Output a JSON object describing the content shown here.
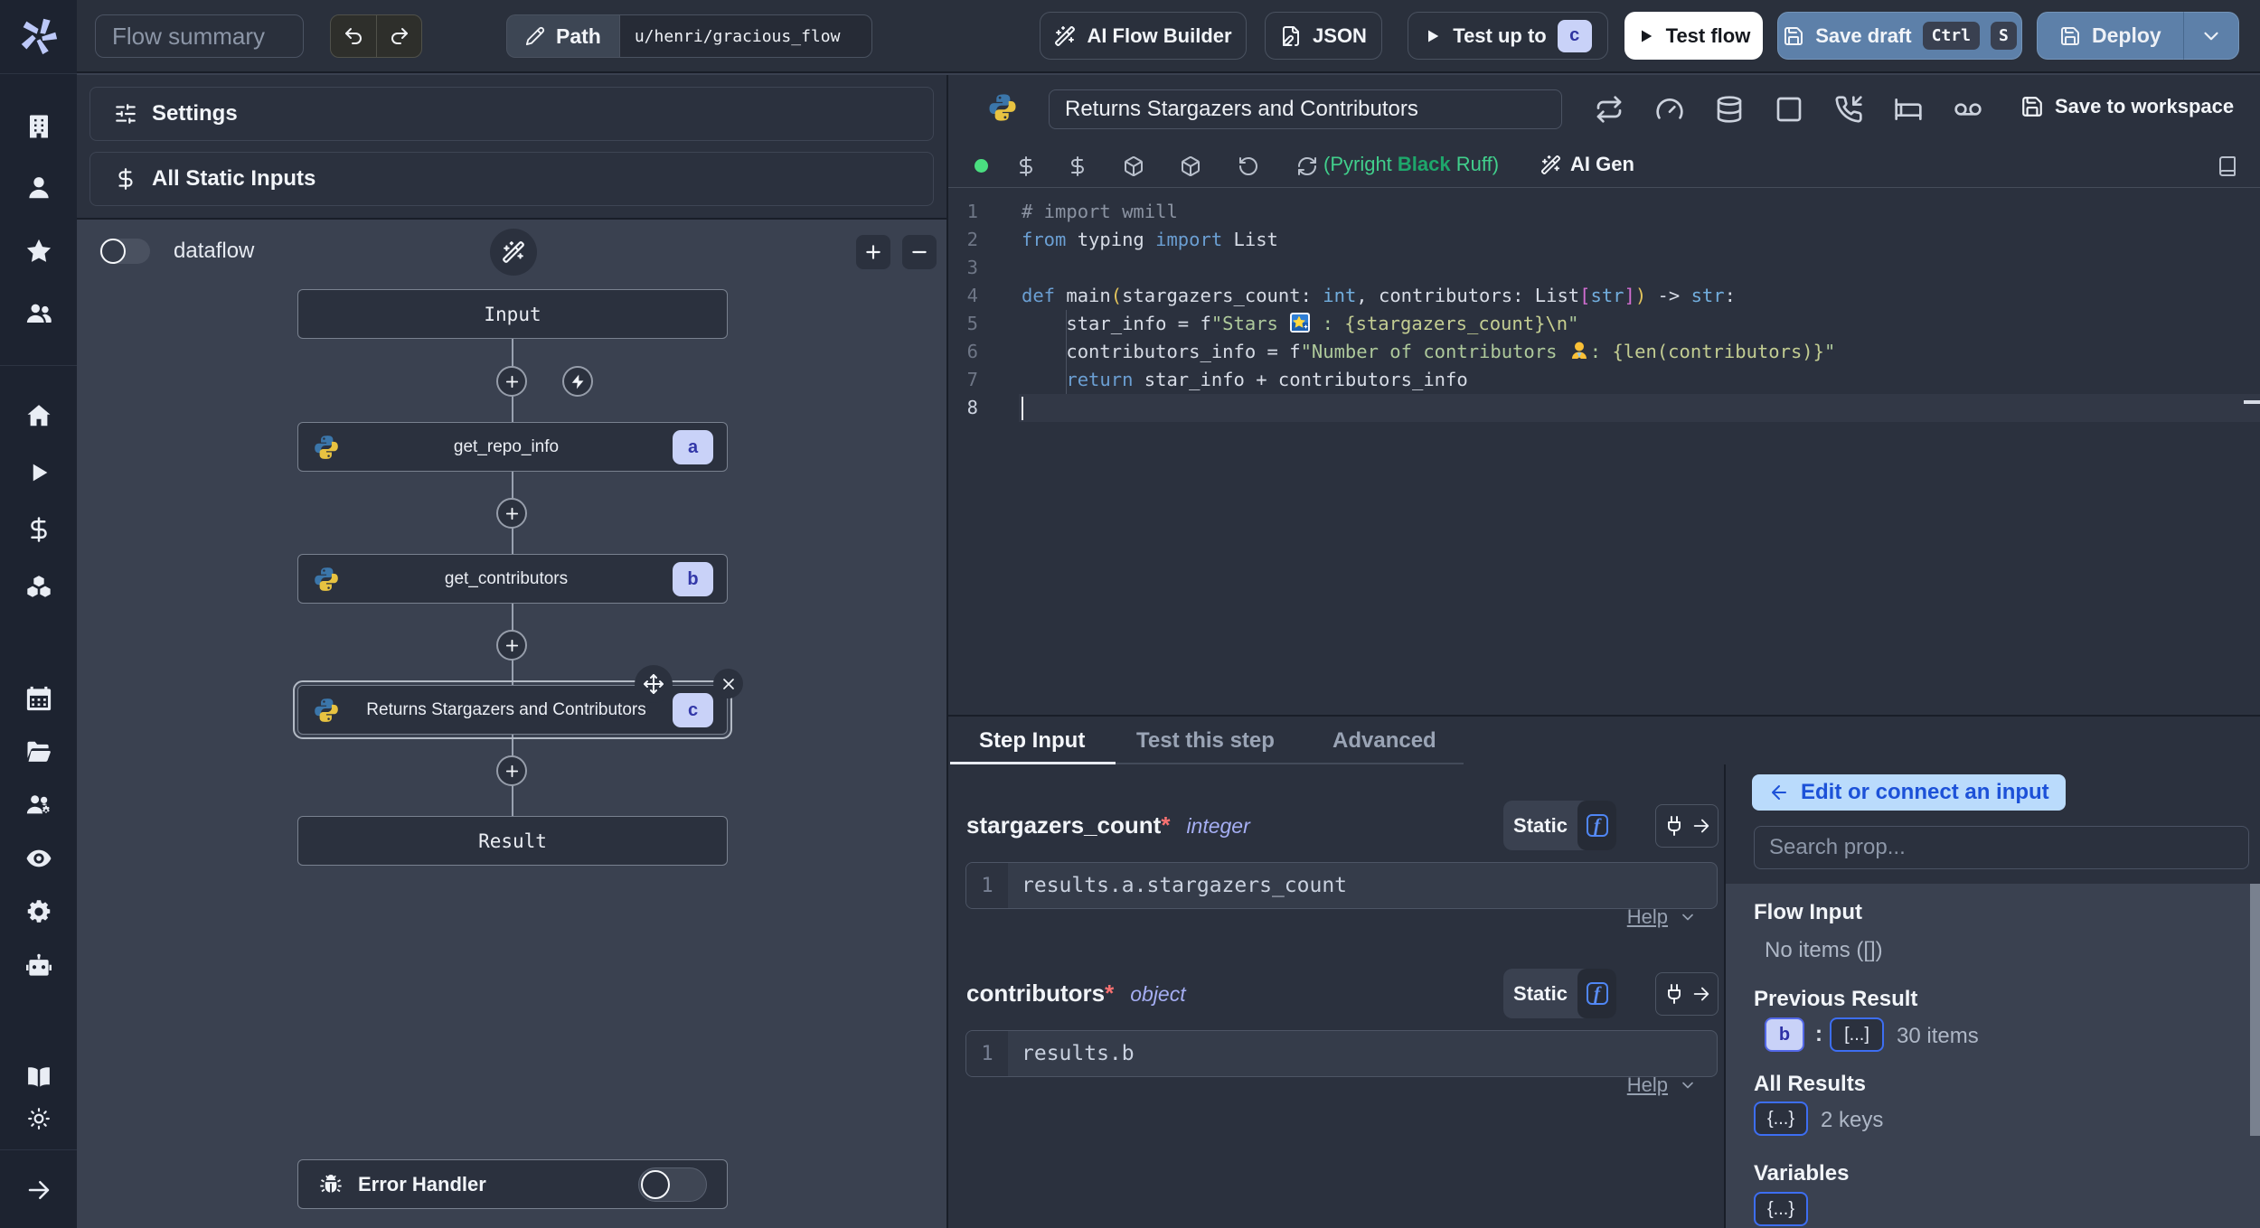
{
  "topbar": {
    "flow_summary_placeholder": "Flow summary",
    "path_label": "Path",
    "path_value": "u/henri/gracious_flow",
    "ai_flow_builder": "AI Flow Builder",
    "json_button": "JSON",
    "test_up_to": "Test up to",
    "test_up_to_badge": "c",
    "test_flow": "Test flow",
    "save_draft": "Save draft",
    "save_draft_keys": [
      "Ctrl",
      "S"
    ],
    "deploy": "Deploy"
  },
  "sidebar": {
    "icons": [
      "windmill-logo",
      "building",
      "user",
      "star",
      "users",
      "home",
      "play",
      "dollar",
      "cubes",
      "calendar",
      "folder-open",
      "users-gear",
      "eye",
      "gear",
      "robot",
      "book-open",
      "sun",
      "arrow-right"
    ]
  },
  "left_panel": {
    "settings": "Settings",
    "all_static_inputs": "All Static Inputs",
    "dataflow_label": "dataflow",
    "error_handler": "Error Handler"
  },
  "graph": {
    "nodes": [
      {
        "label": "Input",
        "kind": "virtual"
      },
      {
        "label": "get_repo_info",
        "badge": "a",
        "icon": "python"
      },
      {
        "label": "get_contributors",
        "badge": "b",
        "icon": "python"
      },
      {
        "label": "Returns Stargazers and Contributors",
        "badge": "c",
        "icon": "python",
        "selected": true
      },
      {
        "label": "Result",
        "kind": "virtual"
      }
    ]
  },
  "editor": {
    "language_icon": "python",
    "title": "Returns Stargazers and Contributors",
    "header_icons": [
      "repeat",
      "gauge",
      "database",
      "square",
      "phone-incoming",
      "bed",
      "voicemail"
    ],
    "save_to_workspace": "Save to workspace",
    "toolbar_icons": [
      "dollar",
      "dollar",
      "box",
      "box",
      "history",
      "refresh"
    ],
    "assistants_prefix": "(Pyright ",
    "assistants_black": "Black",
    "assistants_suffix": " Ruff)",
    "ai_gen": "AI Gen",
    "docs_icon": "book",
    "status_dot_color": "#4ade80",
    "code": {
      "lines": [
        [
          {
            "c": "com",
            "t": "# import wmill"
          }
        ],
        [
          {
            "c": "kw",
            "t": "from"
          },
          {
            "c": "d",
            "t": " typing "
          },
          {
            "c": "kw",
            "t": "import"
          },
          {
            "c": "d",
            "t": " List"
          }
        ],
        [],
        [
          {
            "c": "kw",
            "t": "def"
          },
          {
            "c": "d",
            "t": " main"
          },
          {
            "c": "p1",
            "t": "("
          },
          {
            "c": "d",
            "t": "stargazers_count: "
          },
          {
            "c": "ty",
            "t": "int"
          },
          {
            "c": "d",
            "t": ", contributors: List"
          },
          {
            "c": "p2",
            "t": "["
          },
          {
            "c": "ty",
            "t": "str"
          },
          {
            "c": "p2",
            "t": "]"
          },
          {
            "c": "p1",
            "t": ")"
          },
          {
            "c": "d",
            "t": " -> "
          },
          {
            "c": "ty",
            "t": "str"
          },
          {
            "c": "d",
            "t": ":"
          }
        ],
        [
          {
            "c": "d",
            "t": "    star_info = f"
          },
          {
            "c": "str",
            "t": "\"Stars 🌟 : "
          },
          {
            "c": "interp",
            "t": "{stargazers_count}"
          },
          {
            "c": "esc",
            "t": "\\n"
          },
          {
            "c": "str",
            "t": "\""
          }
        ],
        [
          {
            "c": "d",
            "t": "    contributors_info = f"
          },
          {
            "c": "str",
            "t": "\"Number of contributors 👥: "
          },
          {
            "c": "interp",
            "t": "{len(contributors)}"
          },
          {
            "c": "str",
            "t": "\""
          }
        ],
        [
          {
            "c": "d",
            "t": "    "
          },
          {
            "c": "kw",
            "t": "return"
          },
          {
            "c": "d",
            "t": " star_info + contributors_info"
          }
        ],
        []
      ],
      "active_line": 8
    }
  },
  "tabs": [
    {
      "label": "Step Input",
      "active": true
    },
    {
      "label": "Test this step",
      "active": false
    },
    {
      "label": "Advanced",
      "active": false
    }
  ],
  "step_input": {
    "fields": [
      {
        "name": "stargazers_count",
        "required": "*",
        "type": "integer",
        "mode": "Static",
        "line_no": "1",
        "expr": "results.a.stargazers_count",
        "help": "Help"
      },
      {
        "name": "contributors",
        "required": "*",
        "type": "object",
        "mode": "Static",
        "line_no": "1",
        "expr": "results.b",
        "help": "Help"
      }
    ]
  },
  "prop_picker": {
    "edit_button": "Edit or connect an input",
    "search_placeholder": "Search prop...",
    "flow_input_title": "Flow Input",
    "flow_input_empty": "No items ([])",
    "previous_result_title": "Previous Result",
    "previous_result_badge": "b",
    "previous_result_value": "[...]",
    "previous_result_count": "30 items",
    "all_results_title": "All Results",
    "all_results_value": "{...}",
    "all_results_count": "2 keys",
    "variables_title": "Variables",
    "variables_value": "{...}"
  }
}
